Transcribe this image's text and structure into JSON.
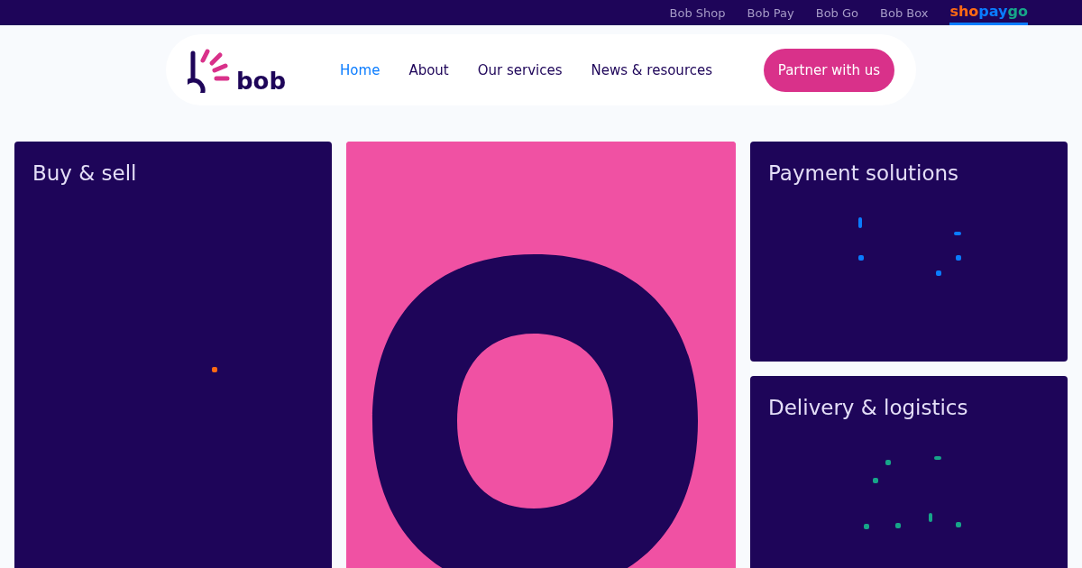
{
  "top_bar": {
    "links": [
      {
        "label": "Bob Shop"
      },
      {
        "label": "Bob Pay"
      },
      {
        "label": "Bob Go"
      },
      {
        "label": "Bob Box"
      }
    ],
    "brand_tab": {
      "selected": true,
      "parts": [
        {
          "text": "sho",
          "color": "#ff6a13"
        },
        {
          "text": "pay",
          "color": "#0a7cff"
        },
        {
          "text": "go",
          "color": "#17a589"
        }
      ]
    }
  },
  "header": {
    "logo": "bob",
    "nav": [
      {
        "label": "Home",
        "selected": true
      },
      {
        "label": "About",
        "selected": false
      },
      {
        "label": "Our services",
        "selected": false
      },
      {
        "label": "News & resources",
        "selected": false
      }
    ],
    "cta": "Partner with us"
  },
  "cards": [
    {
      "title": "Buy & sell",
      "kind": "dark",
      "color": "#ff6a13"
    },
    {
      "kind": "picture"
    },
    {
      "title": "Payment solutions",
      "kind": "dark",
      "color": "#0a7cff"
    },
    {
      "title": "Delivery & logistics",
      "kind": "dark",
      "color": "#17a589"
    }
  ]
}
